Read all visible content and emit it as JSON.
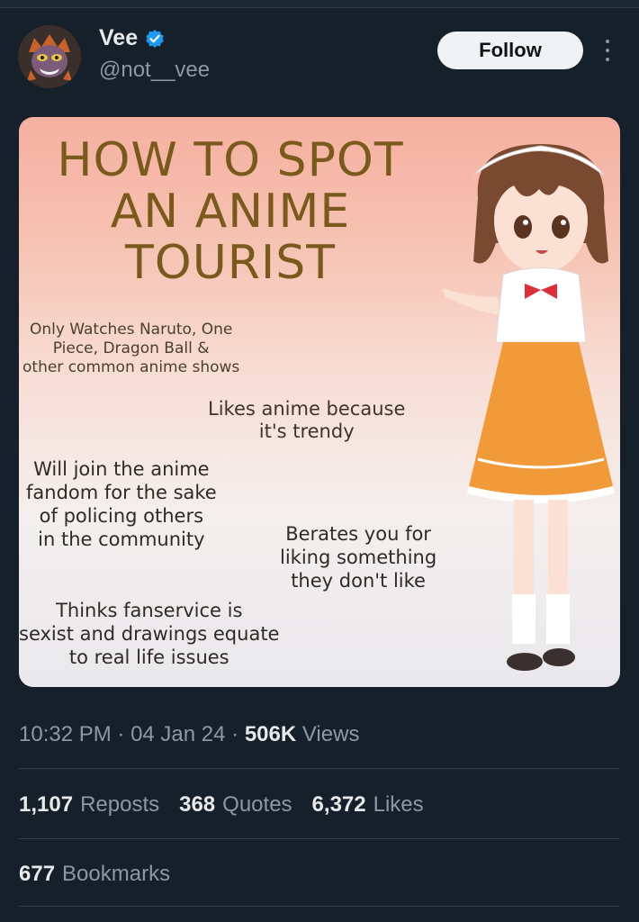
{
  "author": {
    "name": "Vee",
    "handle": "@not__vee",
    "verified_badge": "verified-check-icon",
    "badge_color": "#1d9bf0"
  },
  "follow_label": "Follow",
  "meme": {
    "title": "HOW TO SPOT\nAN ANIME\nTOURIST",
    "points": [
      "Only Watches Naruto, One\nPiece, Dragon Ball &\nother common anime shows",
      "Likes anime because\nit's trendy",
      "Will join the anime\nfandom for the sake\nof policing others\nin the community",
      "Berates you for\nliking something\nthey don't like",
      "Thinks fanservice is\nsexist and drawings equate\nto real life issues"
    ]
  },
  "meta": {
    "time": "10:32 PM",
    "sep1": " · ",
    "date": "04 Jan 24",
    "sep2": " · ",
    "views_count": "506K",
    "views_label": " Views"
  },
  "stats": {
    "reposts_count": "1,107",
    "reposts_label": "Reposts",
    "quotes_count": "368",
    "quotes_label": "Quotes",
    "likes_count": "6,372",
    "likes_label": "Likes"
  },
  "bookmarks": {
    "count": "677",
    "label": "Bookmarks"
  },
  "colors": {
    "background": "#15202b",
    "text": "#e7e9ea",
    "muted": "#8b98a5",
    "divider": "#2f3b47"
  }
}
